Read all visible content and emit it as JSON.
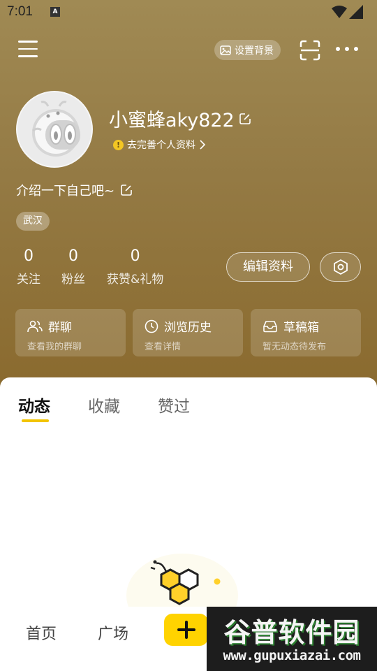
{
  "status_bar": {
    "time": "7:01",
    "notification_letter": "A"
  },
  "header": {
    "set_background_label": "设置背景"
  },
  "profile": {
    "username": "小蜜蜂aky822",
    "complete_profile_label": "去完善个人资料",
    "bio": "介绍一下自己吧~",
    "location": "武汉"
  },
  "stats": [
    {
      "value": "0",
      "label": "关注"
    },
    {
      "value": "0",
      "label": "粉丝"
    },
    {
      "value": "0",
      "label": "获赞&礼物"
    }
  ],
  "actions": {
    "edit_profile_label": "编辑资料"
  },
  "cards": [
    {
      "title": "群聊",
      "subtitle": "查看我的群聊",
      "icon": "people-icon"
    },
    {
      "title": "浏览历史",
      "subtitle": "查看详情",
      "icon": "clock-icon"
    },
    {
      "title": "草稿箱",
      "subtitle": "暂无动态待发布",
      "icon": "inbox-icon"
    }
  ],
  "tabs": [
    {
      "label": "动态",
      "active": true
    },
    {
      "label": "收藏",
      "active": false
    },
    {
      "label": "赞过",
      "active": false
    }
  ],
  "bottom_nav": [
    {
      "label": "首页"
    },
    {
      "label": "广场"
    }
  ],
  "watermark": {
    "brand": "谷普软件园",
    "url": "www.gupuxiazai.com"
  },
  "colors": {
    "accent": "#ffd300",
    "hero_top": "#a08a54",
    "hero_bottom": "#8a6a2e"
  }
}
